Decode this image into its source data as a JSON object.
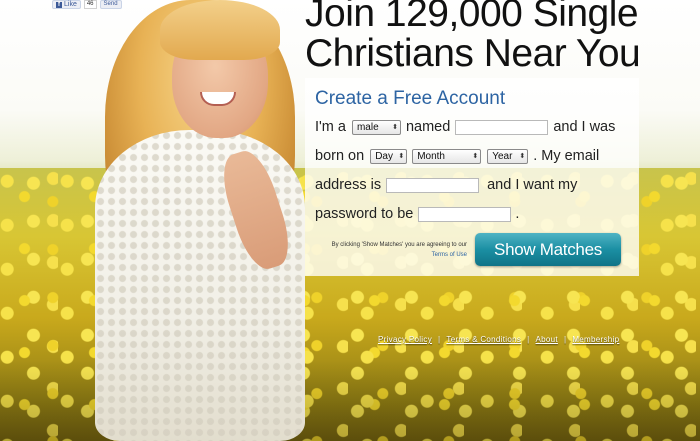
{
  "social": {
    "like_label": "Like",
    "like_count": "46",
    "send_label": "Send"
  },
  "headline": {
    "line1": "Join 129,000 Single",
    "line2": "Christians Near You"
  },
  "signup": {
    "title": "Create a Free Account",
    "text_im_a": "I'm a",
    "gender_select": "male",
    "text_named": "named",
    "name_value": "",
    "text_and_i_was": "and I was",
    "text_born_on": "born on",
    "day_select": "Day",
    "month_select": "Month",
    "year_select": "Year",
    "text_my_email": ". My email",
    "text_address_is": "address is",
    "email_value": "",
    "text_and_i_want_my": "and I want my",
    "text_password_to_be": "password to be",
    "password_value": "",
    "text_period": ".",
    "terms_text": "By clicking 'Show Matches' you are agreeing to our",
    "terms_link": "Terms of Use",
    "submit_label": "Show Matches"
  },
  "footer": {
    "links": [
      "Privacy Policy",
      "Terms & Conditions",
      "About",
      "Membership"
    ],
    "separator": "|"
  }
}
